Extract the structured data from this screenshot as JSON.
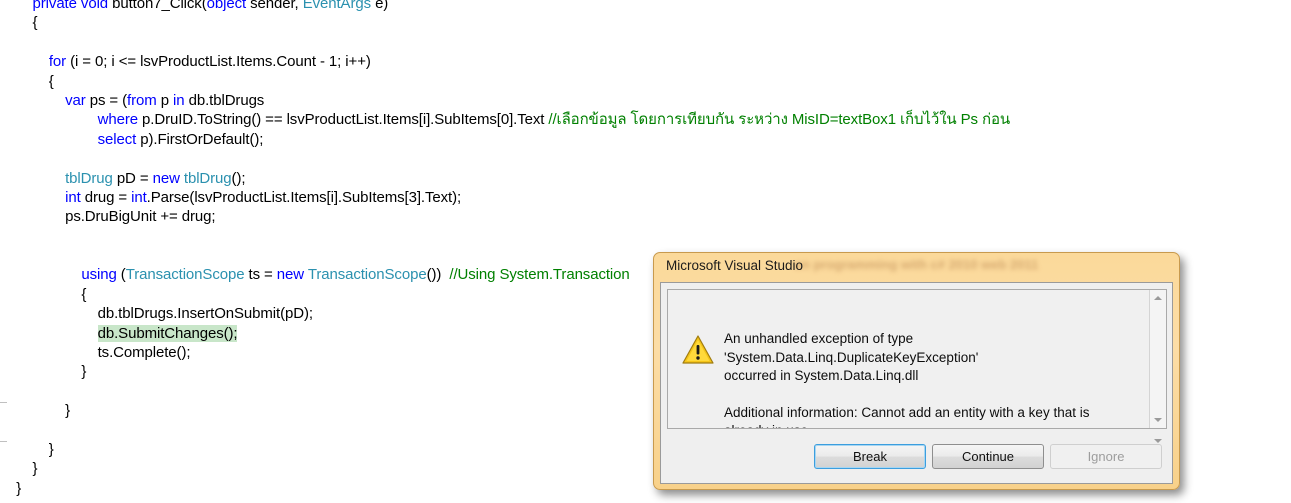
{
  "editor": {
    "language": "csharp",
    "code_lines": [
      [
        {
          "t": "        ",
          "s": "plain"
        },
        {
          "t": "private void ",
          "s": "keyword"
        },
        {
          "t": "button7_Click(",
          "s": "plain"
        },
        {
          "t": "object",
          "s": "keyword"
        },
        {
          "t": " sender, ",
          "s": "plain"
        },
        {
          "t": "EventArgs",
          "s": "type"
        },
        {
          "t": " e)",
          "s": "plain"
        }
      ],
      [
        {
          "t": "        {",
          "s": "plain"
        }
      ],
      [
        {
          "t": "",
          "s": "plain"
        }
      ],
      [
        {
          "t": "            ",
          "s": "plain"
        },
        {
          "t": "for",
          "s": "keyword"
        },
        {
          "t": " (i = 0; i <= lsvProductList.Items.Count - 1; i++)",
          "s": "plain"
        }
      ],
      [
        {
          "t": "            {",
          "s": "plain"
        }
      ],
      [
        {
          "t": "                ",
          "s": "plain"
        },
        {
          "t": "var",
          "s": "keyword"
        },
        {
          "t": " ps = (",
          "s": "plain"
        },
        {
          "t": "from",
          "s": "keyword"
        },
        {
          "t": " p ",
          "s": "plain"
        },
        {
          "t": "in",
          "s": "keyword"
        },
        {
          "t": " db.tblDrugs",
          "s": "plain"
        }
      ],
      [
        {
          "t": "                        ",
          "s": "plain"
        },
        {
          "t": "where",
          "s": "keyword"
        },
        {
          "t": " p.DruID.ToString() == lsvProductList.Items[i].SubItems[0].Text ",
          "s": "plain"
        },
        {
          "t": "//เลือกข้อมูล โดยการเทียบกัน ระหว่าง MisID=textBox1 เก็บไว้ใน Ps ก่อน",
          "s": "comment"
        }
      ],
      [
        {
          "t": "                        ",
          "s": "plain"
        },
        {
          "t": "select",
          "s": "keyword"
        },
        {
          "t": " p).FirstOrDefault();",
          "s": "plain"
        }
      ],
      [
        {
          "t": "",
          "s": "plain"
        }
      ],
      [
        {
          "t": "                ",
          "s": "plain"
        },
        {
          "t": "tblDrug",
          "s": "type"
        },
        {
          "t": " pD = ",
          "s": "plain"
        },
        {
          "t": "new",
          "s": "keyword"
        },
        {
          "t": " ",
          "s": "plain"
        },
        {
          "t": "tblDrug",
          "s": "type"
        },
        {
          "t": "();",
          "s": "plain"
        }
      ],
      [
        {
          "t": "                ",
          "s": "plain"
        },
        {
          "t": "int",
          "s": "keyword"
        },
        {
          "t": " drug = ",
          "s": "plain"
        },
        {
          "t": "int",
          "s": "keyword"
        },
        {
          "t": ".Parse(lsvProductList.Items[i].SubItems[3].Text);",
          "s": "plain"
        }
      ],
      [
        {
          "t": "                ps.DruBigUnit += drug;",
          "s": "plain"
        }
      ],
      [
        {
          "t": "",
          "s": "plain"
        }
      ],
      [
        {
          "t": "",
          "s": "plain"
        }
      ],
      [
        {
          "t": "                    ",
          "s": "plain"
        },
        {
          "t": "using",
          "s": "keyword"
        },
        {
          "t": " (",
          "s": "plain"
        },
        {
          "t": "TransactionScope",
          "s": "type"
        },
        {
          "t": " ts = ",
          "s": "plain"
        },
        {
          "t": "new",
          "s": "keyword"
        },
        {
          "t": " ",
          "s": "plain"
        },
        {
          "t": "TransactionScope",
          "s": "type"
        },
        {
          "t": "())  ",
          "s": "plain"
        },
        {
          "t": "//Using System.Transaction",
          "s": "comment"
        }
      ],
      [
        {
          "t": "                    {",
          "s": "plain"
        }
      ],
      [
        {
          "t": "                        db.tblDrugs.InsertOnSubmit(pD);",
          "s": "plain"
        }
      ],
      [
        {
          "t": "                        ",
          "s": "plain"
        },
        {
          "t": "db.SubmitChanges();",
          "s": "highlight"
        }
      ],
      [
        {
          "t": "                        ts.Complete();",
          "s": "plain"
        }
      ],
      [
        {
          "t": "                    }",
          "s": "plain"
        }
      ],
      [
        {
          "t": "",
          "s": "plain"
        }
      ],
      [
        {
          "t": "                }",
          "s": "plain"
        }
      ],
      [
        {
          "t": "",
          "s": "plain"
        }
      ],
      [
        {
          "t": "            }",
          "s": "plain"
        }
      ],
      [
        {
          "t": "        }",
          "s": "plain"
        }
      ],
      [
        {
          "t": "    }",
          "s": "plain"
        }
      ]
    ],
    "colors": {
      "keyword": "#0000ff",
      "type": "#2b91af",
      "comment": "#008000",
      "plain": "#000000",
      "highlight_bg": "#c8e6c9",
      "background": "#ffffff"
    }
  },
  "dialog": {
    "title": "Microsoft Visual Studio",
    "title_ghost_text": "on programming with c# 2010 web 2011",
    "icon": "warning-triangle-icon",
    "message_line1": "An unhandled exception of type 'System.Data.Linq.DuplicateKeyException'",
    "message_line2": "occurred in System.Data.Linq.dll",
    "message_line3": "Additional information: Cannot add an entity with a key that is already in use.",
    "buttons": [
      {
        "label": "Break",
        "state": "focused"
      },
      {
        "label": "Continue",
        "state": "default"
      },
      {
        "label": "Ignore",
        "state": "disabled"
      }
    ],
    "scrollbar": {
      "up_arrow": "scroll-up-arrow-icon",
      "down_arrow": "scroll-down-arrow-icon"
    },
    "colors": {
      "frame": "#fbd99a",
      "frame_border": "#c89a4e",
      "body": "#efefef",
      "focus_ring": "#3c9ede"
    }
  }
}
